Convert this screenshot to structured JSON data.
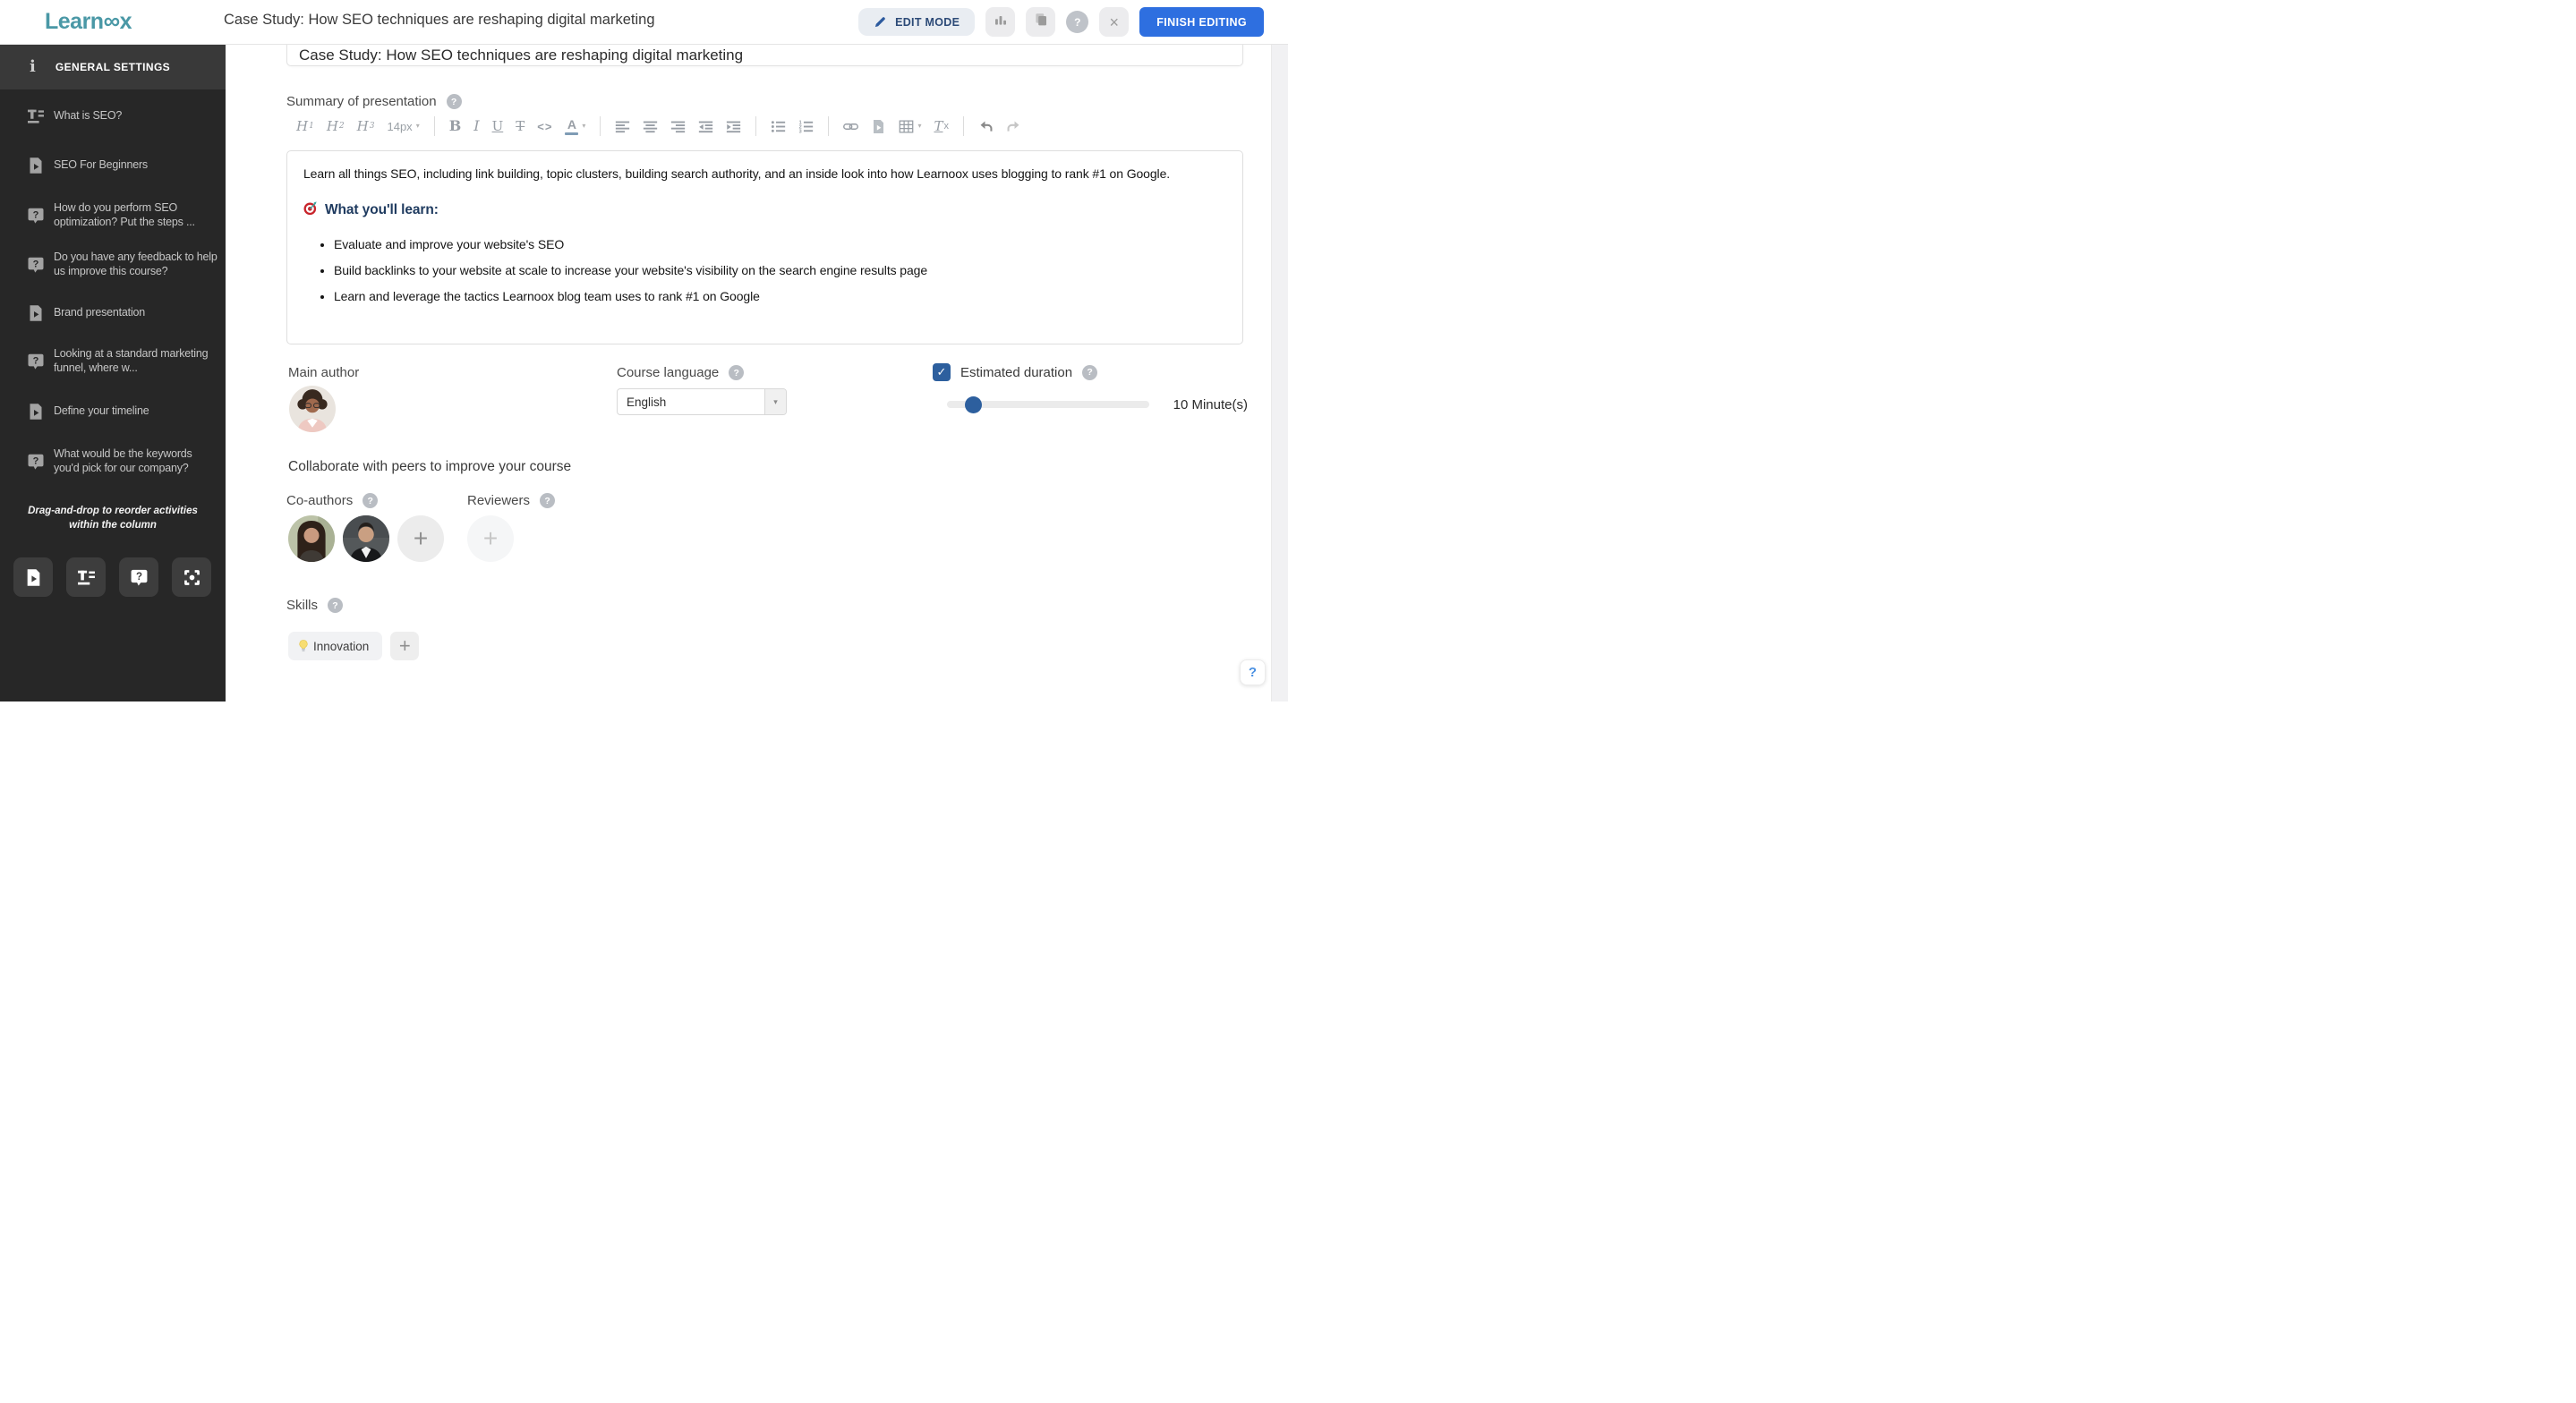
{
  "header": {
    "logo_prefix": "Learn",
    "logo_mark": "∞",
    "logo_suffix": "x",
    "title": "Case Study: How SEO techniques are reshaping digital marketing",
    "edit_mode_label": "EDIT MODE",
    "finish_editing_label": "FINISH EDITING",
    "help_glyph": "?",
    "close_glyph": "×"
  },
  "sidebar": {
    "section_header": "GENERAL SETTINGS",
    "info_glyph": "i",
    "items": [
      {
        "label": "What is SEO?",
        "icon": "text-activity"
      },
      {
        "label": "SEO For Beginners",
        "icon": "doc-play"
      },
      {
        "label": "How do you perform SEO optimization? Put the steps ...",
        "icon": "question-bubble"
      },
      {
        "label": "Do you have any feedback to help us improve this course?",
        "icon": "question-bubble"
      },
      {
        "label": "Brand presentation",
        "icon": "doc-play"
      },
      {
        "label": "Looking at a standard marketing funnel, where w...",
        "icon": "question-bubble"
      },
      {
        "label": "Define your timeline",
        "icon": "doc-play"
      },
      {
        "label": "What would be the keywords you'd pick for our company?",
        "icon": "question-bubble"
      }
    ],
    "reorder_note": "Drag-and-drop to reorder activities within the column",
    "activity_buttons": [
      {
        "name": "video-activity",
        "icon": "doc-play"
      },
      {
        "name": "text-activity",
        "icon": "text-activity"
      },
      {
        "name": "question-activity",
        "icon": "question-bubble"
      },
      {
        "name": "embed-activity",
        "icon": "focus"
      }
    ]
  },
  "editor_toolbar": {
    "groups": [
      [
        {
          "name": "heading-1",
          "glyph": "H1"
        },
        {
          "name": "heading-2",
          "glyph": "H2"
        },
        {
          "name": "heading-3",
          "glyph": "H3"
        },
        {
          "name": "font-size-select",
          "glyph": "14px",
          "caret": true
        }
      ],
      [
        {
          "name": "bold",
          "glyph": "B"
        },
        {
          "name": "italic",
          "glyph": "I"
        },
        {
          "name": "underline",
          "glyph": "U"
        },
        {
          "name": "strikethrough",
          "glyph": "T"
        },
        {
          "name": "code",
          "glyph": "<>"
        },
        {
          "name": "font-color",
          "glyph": "A",
          "caret": true
        }
      ],
      [
        {
          "name": "align-left",
          "icon": "align-left"
        },
        {
          "name": "align-center",
          "icon": "align-center"
        },
        {
          "name": "align-right",
          "icon": "align-right"
        },
        {
          "name": "indent-decrease",
          "icon": "indent-dec"
        },
        {
          "name": "indent-increase",
          "icon": "indent-inc"
        }
      ],
      [
        {
          "name": "unordered-list",
          "icon": "list-ul"
        },
        {
          "name": "ordered-list",
          "icon": "list-ol"
        }
      ],
      [
        {
          "name": "insert-link",
          "icon": "link"
        },
        {
          "name": "insert-media",
          "icon": "doc-play"
        },
        {
          "name": "insert-table",
          "icon": "table",
          "caret": true
        },
        {
          "name": "clear-formatting",
          "glyph": "Tx"
        }
      ],
      [
        {
          "name": "undo",
          "icon": "undo"
        },
        {
          "name": "redo",
          "icon": "redo"
        }
      ]
    ]
  },
  "course": {
    "title_value": "Case Study: How SEO techniques are reshaping digital marketing",
    "summary_label": "Summary of presentation",
    "summary": {
      "paragraph": "Learn all things SEO, including link building, topic clusters, building search authority, and an inside look into how Learnoox uses blogging to rank #1 on Google.",
      "heading": "What you'll learn:",
      "bullets": [
        "Evaluate and improve your website's SEO",
        "Build backlinks to your website at scale to increase your website's visibility on the search engine results page",
        "Learn and leverage the tactics Learnoox blog team uses to rank #1 on Google"
      ]
    },
    "main_author_label": "Main author",
    "course_language_label": "Course language",
    "language_value": "English",
    "estimated_duration_label": "Estimated duration",
    "estimated_duration_checked": true,
    "duration_value": "10 Minute(s)",
    "collaborate_heading": "Collaborate with peers to improve your course",
    "coauthors_label": "Co-authors",
    "reviewers_label": "Reviewers",
    "skills_label": "Skills",
    "skills": [
      {
        "label": "Innovation"
      }
    ],
    "help_fab_glyph": "?"
  },
  "colors": {
    "brand_teal": "#4a98a6",
    "primary_blue": "#2e6fe0",
    "checkbox_blue": "#2d5f9e",
    "navy_text": "#2c4a77",
    "heading_navy": "#1e3a5f"
  }
}
